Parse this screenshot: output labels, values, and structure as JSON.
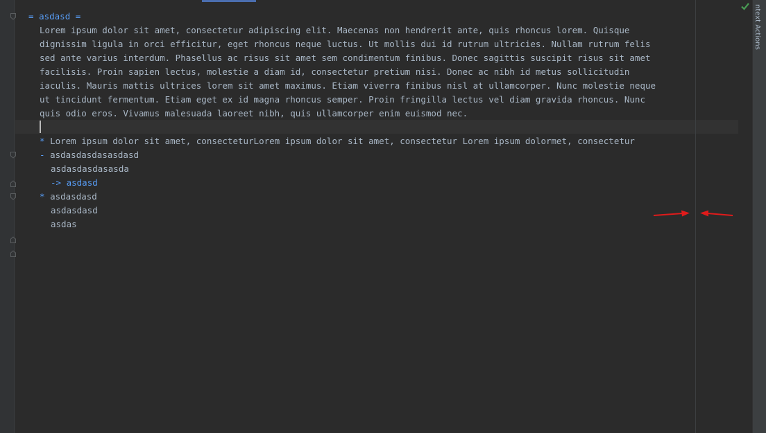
{
  "colors": {
    "background": "#2b2b2b",
    "text": "#a9b7c6",
    "markup": "#589df6",
    "annotation_arrow": "#e01b1b",
    "check": "#499c54"
  },
  "right_panel": {
    "label": "ntext Actions",
    "status_icon": "check-icon"
  },
  "document": {
    "heading": {
      "marker_open": "= ",
      "title": "asdasd",
      "marker_close": " ="
    },
    "paragraph_lines": [
      "Lorem ipsum dolor sit amet, consectetur adipiscing elit. Maecenas non hendrerit ante, quis rhoncus lorem. Quisque",
      "dignissim ligula in orci efficitur, eget rhoncus neque luctus. Ut mollis dui id rutrum ultricies. Nullam rutrum felis",
      "sed ante varius interdum. Phasellus ac risus sit amet sem condimentum finibus. Donec sagittis suscipit risus sit amet",
      "facilisis. Proin sapien lectus, molestie a diam id, consectetur pretium nisi. Donec ac nibh id metus sollicitudin",
      "iaculis. Mauris mattis ultrices lorem sit amet maximus. Etiam viverra finibus nisl at ullamcorper. Nunc molestie neque",
      "ut tincidunt fermentum. Etiam eget ex id magna rhoncus semper. Proin fringilla lectus vel diam gravida rhoncus. Nunc",
      "quis odio eros. Vivamus malesuada laoreet nibh, quis ullamcorper enim euismod nec."
    ],
    "list": {
      "item1_marker": "*",
      "item1_text": "Lorem ipsum dolor sit amet, consecteturLorem ipsum dolor sit amet, consectetur Lorem ipsum dolormet, consectetur",
      "item2_marker": "-",
      "item2_line1": "asdasdasdasasdasd",
      "item2_line2": "asdasdasdasasda",
      "item2_arrow": "->",
      "item2_ref": "asdasd",
      "item3_marker": "*",
      "item3_line1": "asdasdasd",
      "item3_line2": "asdasdasd",
      "item3_line3": "asdas"
    }
  }
}
